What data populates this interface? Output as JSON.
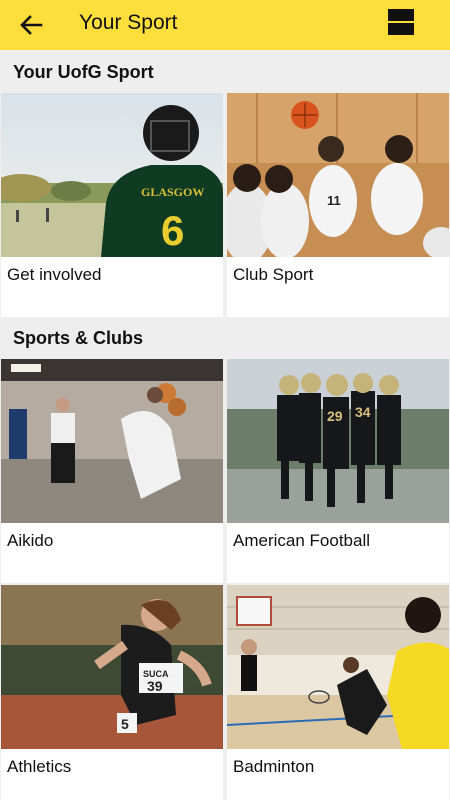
{
  "appbar": {
    "title": "Your Sport",
    "back_icon": "arrow-left-icon",
    "menu_icon": "view-toggle-icon"
  },
  "sections": [
    {
      "title": "Your UofG Sport",
      "cards": [
        {
          "label": "Get involved",
          "image": "player-glasgow-6-jersey"
        },
        {
          "label": "Club Sport",
          "image": "basketball-team-seated"
        }
      ]
    },
    {
      "title": "Sports & Clubs",
      "cards": [
        {
          "label": "Aikido",
          "image": "aikido-practice"
        },
        {
          "label": "American Football",
          "image": "american-football-team"
        },
        {
          "label": "Athletics",
          "image": "sprinter-suca-39"
        },
        {
          "label": "Badminton",
          "image": "badminton-players"
        }
      ]
    }
  ],
  "colors": {
    "accent": "#fdde3a",
    "background": "#eeeeee",
    "card": "#ffffff"
  }
}
